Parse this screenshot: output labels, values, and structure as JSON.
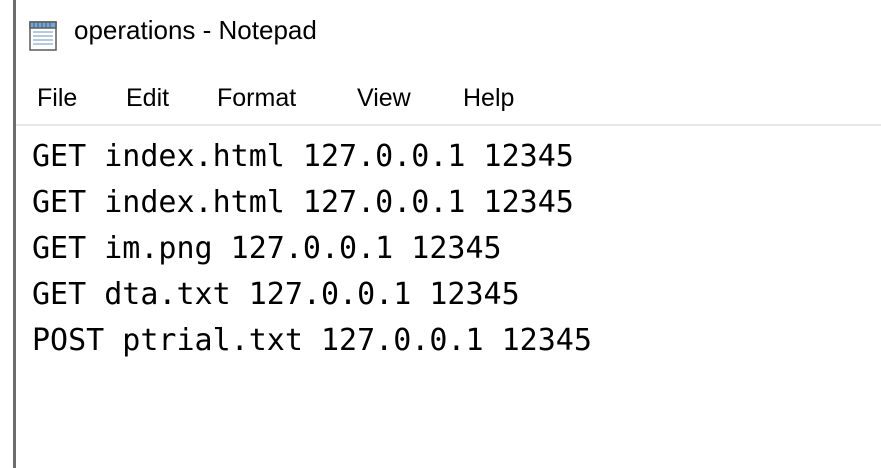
{
  "window": {
    "title": "operations - Notepad"
  },
  "icons": {
    "app_icon": "notepad-icon"
  },
  "menu": {
    "items": [
      {
        "label": "File"
      },
      {
        "label": "Edit"
      },
      {
        "label": "Format"
      },
      {
        "label": "View"
      },
      {
        "label": "Help"
      }
    ]
  },
  "editor": {
    "lines": [
      "GET index.html 127.0.0.1 12345",
      "GET index.html 127.0.0.1 12345",
      "GET im.png 127.0.0.1 12345",
      "GET dta.txt 127.0.0.1 12345",
      "POST ptrial.txt 127.0.0.1 12345"
    ]
  },
  "colors": {
    "background": "#ffffff",
    "text": "#000000",
    "left_border": "#6d6d6d",
    "icon_blue": "#6fa8dc"
  }
}
